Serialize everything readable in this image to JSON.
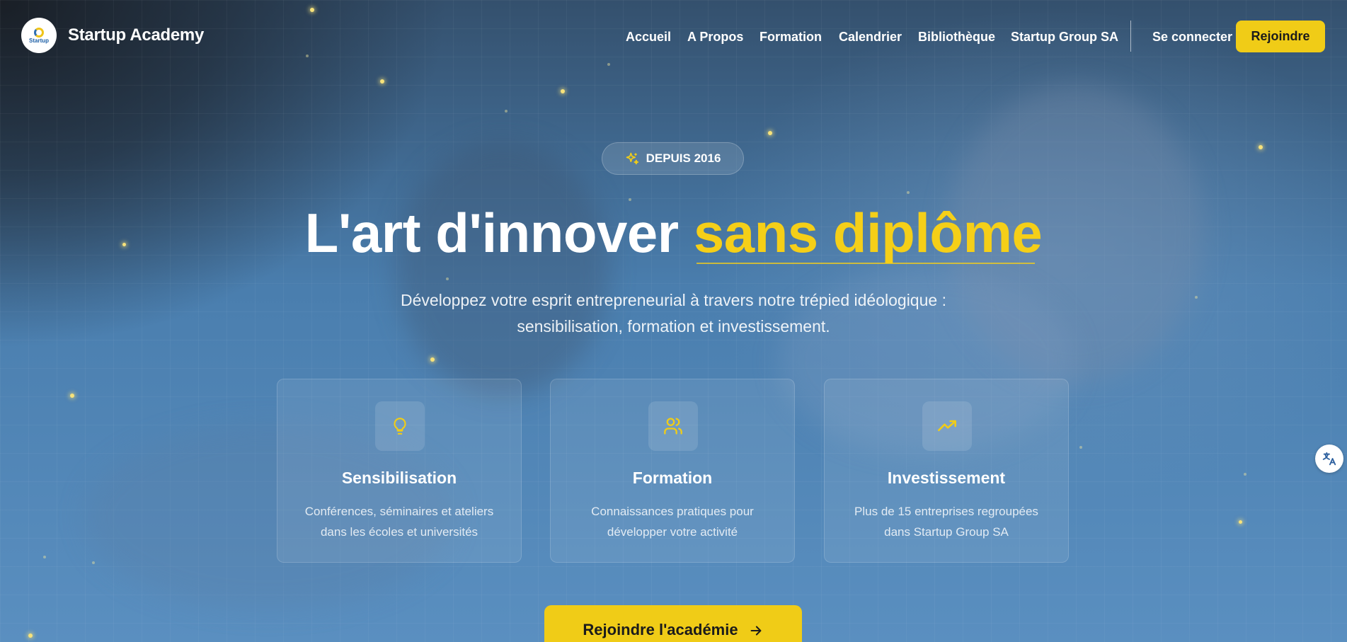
{
  "brand": {
    "name": "Startup Academy",
    "logo_text": "Startup"
  },
  "nav": {
    "links": [
      "Accueil",
      "A Propos",
      "Formation",
      "Calendrier",
      "Bibliothèque",
      "Startup Group SA"
    ],
    "login_label": "Se connecter",
    "join_label": "Rejoindre"
  },
  "hero": {
    "badge": "DEPUIS 2016",
    "title_part1": "L'art d'innover ",
    "title_highlight": "sans diplôme",
    "subtitle_line1": "Développez votre esprit entrepreneurial à travers notre trépied idéologique :",
    "subtitle_line2": "sensibilisation, formation et investissement.",
    "cta_label": "Rejoindre l'académie"
  },
  "cards": [
    {
      "icon": "lightbulb-icon",
      "title": "Sensibilisation",
      "desc_line1": "Conférences, séminaires et ateliers",
      "desc_line2": "dans les écoles et universités"
    },
    {
      "icon": "users-icon",
      "title": "Formation",
      "desc_line1": "Connaissances pratiques pour",
      "desc_line2": "développer votre activité"
    },
    {
      "icon": "trending-up-icon",
      "title": "Investissement",
      "desc_line1": "Plus de 15 entreprises regroupées",
      "desc_line2": "dans Startup Group SA"
    }
  ],
  "colors": {
    "accent": "#F0CC17",
    "text": "#FFFFFF",
    "background": "#4A7FAE"
  }
}
